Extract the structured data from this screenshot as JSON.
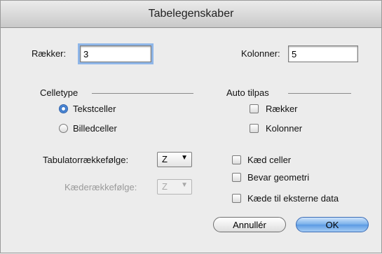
{
  "window": {
    "title": "Tabelegenskaber"
  },
  "rows": {
    "label": "Rækker:",
    "value": "3"
  },
  "columns": {
    "label": "Kolonner:",
    "value": "5"
  },
  "cell_type": {
    "heading": "Celletype",
    "options": [
      {
        "label": "Tekstceller",
        "selected": true
      },
      {
        "label": "Billedceller",
        "selected": false
      }
    ]
  },
  "auto_fit": {
    "heading": "Auto tilpas",
    "options": [
      {
        "label": "Rækker",
        "checked": false
      },
      {
        "label": "Kolonner",
        "checked": false
      }
    ]
  },
  "tab_order": {
    "label": "Tabulatorrækkefølge:",
    "value": "Z"
  },
  "chain_order": {
    "label": "Kæderækkefølge:",
    "value": "Z",
    "disabled": true
  },
  "options": [
    {
      "label": "Kæd celler",
      "checked": false
    },
    {
      "label": "Bevar geometri",
      "checked": false
    },
    {
      "label": "Kæde til eksterne data",
      "checked": false
    }
  ],
  "buttons": {
    "cancel": "Annullér",
    "ok": "OK"
  },
  "icons": {
    "dropdown": "chevron-down-icon"
  }
}
